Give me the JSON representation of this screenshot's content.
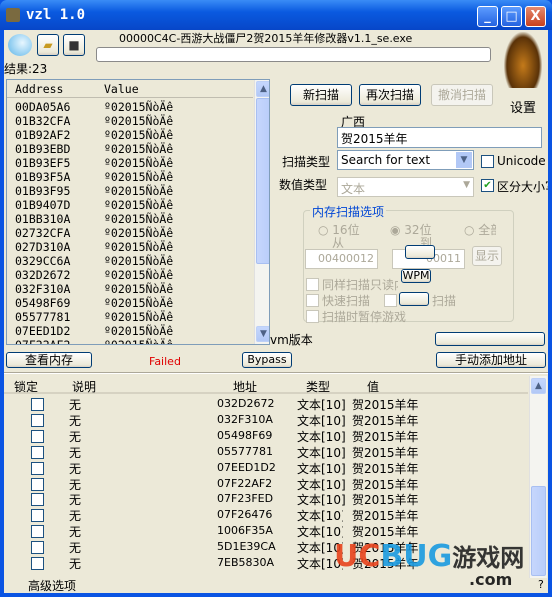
{
  "window": {
    "title": "vzl 1.0",
    "minimize": "_",
    "maximize": "□",
    "close": "X"
  },
  "toolbar": {
    "process_title": "00000C4C-西游大战僵尸2贺2015羊年修改器v1.1_se.exe",
    "results_label": "结果:23",
    "settings_label": "设置",
    "progress": 0
  },
  "scan_list": {
    "headers": [
      "Address",
      "Value"
    ],
    "rows": [
      [
        "00DA05A6",
        "º02015ÑòÄê"
      ],
      [
        "01B32CFA",
        "º02015ÑòÄê"
      ],
      [
        "01B92AF2",
        "º02015ÑòÄê"
      ],
      [
        "01B93EBD",
        "º02015ÑòÄê"
      ],
      [
        "01B93EF5",
        "º02015ÑòÄê"
      ],
      [
        "01B93F5A",
        "º02015ÑòÄê"
      ],
      [
        "01B93F95",
        "º02015ÑòÄê"
      ],
      [
        "01B9407D",
        "º02015ÑòÄê"
      ],
      [
        "01BB310A",
        "º02015ÑòÄê"
      ],
      [
        "02732CFA",
        "º02015ÑòÄê"
      ],
      [
        "027D310A",
        "º02015ÑòÄê"
      ],
      [
        "0329CC6A",
        "º02015ÑòÄê"
      ],
      [
        "032D2672",
        "º02015ÑòÄê"
      ],
      [
        "032F310A",
        "º02015ÑòÄê"
      ],
      [
        "05498F69",
        "º02015ÑòÄê"
      ],
      [
        "05577781",
        "º02015ÑòÄê"
      ],
      [
        "07EED1D2",
        "º02015ÑòÄê"
      ],
      [
        "07F22AF2",
        "º02015ÑòÄê"
      ]
    ]
  },
  "buttons": {
    "view_memory": "查看内存",
    "status": "Failed",
    "bypass": "Bypass",
    "new_scan": "新扫描",
    "next_scan": "再次扫描",
    "undo_scan": "撤消扫描",
    "manual_add": "手动添加地址",
    "show": "显示",
    "wpm": "WPM"
  },
  "scan_options": {
    "value_label": "广西",
    "value": "贺2015羊年",
    "scan_type_label": "扫描类型",
    "scan_type": "Search for text",
    "value_type_label": "数值类型",
    "value_type": "文本",
    "unicode_label": "Unicode",
    "unicode_checked": false,
    "case_label": "区分大小写",
    "case_checked": true,
    "group_title": "内存扫描选项",
    "radio_16": "16位",
    "radio_32": "32位",
    "radio_all": "全部",
    "from_label": "从",
    "to_label": "到",
    "from_value": "00400012",
    "to_value": "00011",
    "readonly_label": "同样扫描只读内存",
    "fast_label": "快速扫描",
    "other_label": "扫描",
    "pause_label": "扫描时暂停游戏",
    "vm_label": "vm版本"
  },
  "address_table": {
    "headers": [
      "锁定",
      "说明",
      "地址",
      "类型",
      "值"
    ],
    "rows": [
      [
        "无",
        "032D2672",
        "文本[10]",
        "贺2015羊年"
      ],
      [
        "无",
        "032F310A",
        "文本[10]",
        "贺2015羊年"
      ],
      [
        "无",
        "05498F69",
        "文本[10]",
        "贺2015羊年"
      ],
      [
        "无",
        "05577781",
        "文本[10]",
        "贺2015羊年"
      ],
      [
        "无",
        "07EED1D2",
        "文本[10]",
        "贺2015羊年"
      ],
      [
        "无",
        "07F22AF2",
        "文本[10]",
        "贺2015羊年"
      ],
      [
        "无",
        "07F23FED",
        "文本[10]",
        "贺2015羊年"
      ],
      [
        "无",
        "07F26476",
        "文本[10]",
        "贺2015羊年"
      ],
      [
        "无",
        "1006F35A",
        "文本[10]",
        "贺2015羊年"
      ],
      [
        "无",
        "5D1E39CA",
        "文本[10]",
        "贺2015羊年"
      ],
      [
        "无",
        "7EB5830A",
        "文本[10]",
        "贺2015羊年"
      ]
    ]
  },
  "footer": {
    "advanced": "高级选项",
    "help": "?"
  },
  "watermark": {
    "text": "UCBUG游戏网",
    ".com": ".com"
  }
}
